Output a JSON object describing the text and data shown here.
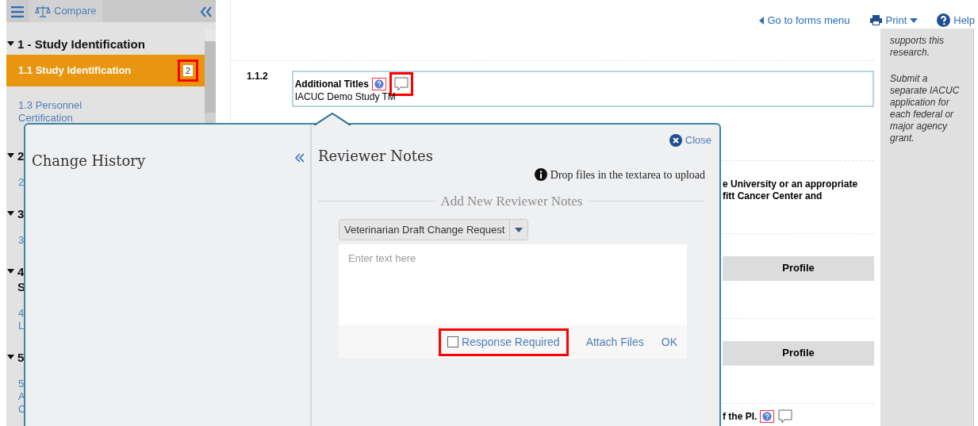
{
  "sidebar": {
    "compare_label": "Compare",
    "sections": [
      {
        "title": "1 - Study Identification",
        "expanded": true,
        "items": [
          {
            "label": "1.1 Study Identification",
            "selected": true,
            "badge": "2"
          },
          {
            "label": "1.3 Personnel Certification",
            "selected": false
          }
        ]
      },
      {
        "title": "2",
        "expanded": true,
        "items": [
          {
            "label": "2",
            "selected": false
          }
        ]
      },
      {
        "title": "3",
        "expanded": true,
        "items": [
          {
            "label": "3",
            "selected": false
          }
        ]
      },
      {
        "title": "4 S",
        "expanded": true,
        "items": [
          {
            "label": "4 L",
            "selected": false
          }
        ]
      },
      {
        "title": "5",
        "expanded": true,
        "items": [
          {
            "label": "5 A C",
            "selected": false
          }
        ]
      }
    ]
  },
  "toolbar": {
    "links": [
      {
        "kind": "back",
        "label": "Go to forms menu"
      },
      {
        "kind": "print",
        "label": "Print"
      },
      {
        "kind": "help",
        "label": "Help"
      }
    ]
  },
  "question": {
    "number": "1.1.2",
    "label": "Additional Titles",
    "value": "IACUC Demo Study TM"
  },
  "partial_question": {
    "lines": [
      "e University or an appropriate",
      "fitt Cancer Center and"
    ]
  },
  "profile_bars": [
    "Profile",
    "Profile"
  ],
  "last_question": {
    "text": "f the PI."
  },
  "help_panel": {
    "paragraphs": [
      "supports this research.",
      "Submit a separate IACUC application for each federal or major agency grant."
    ]
  },
  "popup": {
    "close_label": "Close",
    "history_title": "Change History",
    "notes_title": "Reviewer Notes",
    "upload_hint": "Drop files in the textarea to upload",
    "legend": "Add New Reviewer Notes",
    "note_type": "Veterinarian Draft Change Request",
    "placeholder": "Enter text here",
    "response_required": {
      "label": "Response Required",
      "checked": false
    },
    "actions": [
      "Attach Files",
      "OK"
    ]
  }
}
